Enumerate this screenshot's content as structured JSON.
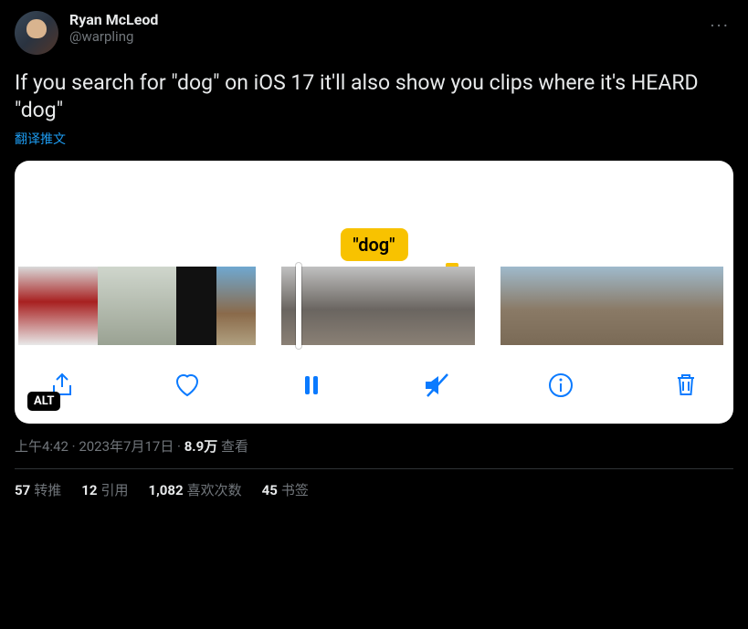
{
  "author": {
    "display_name": "Ryan McLeod",
    "handle": "@warpling"
  },
  "tweet_text": "If you search for \"dog\" on iOS 17 it'll also show you clips where it's HEARD \"dog\"",
  "translate_label": "翻译推文",
  "media": {
    "caption_bubble": "\"dog\"",
    "alt_badge": "ALT",
    "toolbar": {
      "share": "share",
      "like": "like",
      "pause": "pause",
      "mute": "mute",
      "info": "info",
      "delete": "delete"
    }
  },
  "meta": {
    "time": "上午4:42",
    "date": "2023年7月17日",
    "separator": " · ",
    "views_count": "8.9万",
    "views_label": " 查看"
  },
  "stats": {
    "retweets": {
      "count": "57",
      "label": "转推"
    },
    "quotes": {
      "count": "12",
      "label": "引用"
    },
    "likes": {
      "count": "1,082",
      "label": "喜欢次数"
    },
    "bookmarks": {
      "count": "45",
      "label": "书签"
    }
  }
}
